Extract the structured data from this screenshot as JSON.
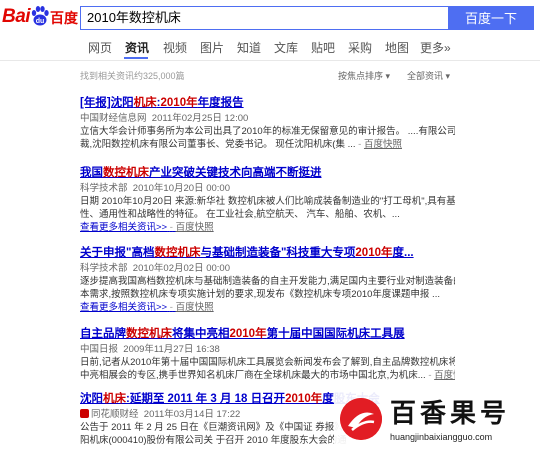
{
  "header": {
    "logo_bai": "Bai",
    "logo_du": "百度",
    "search_value": "2010年数控机床",
    "search_button": "百度一下"
  },
  "tabs": [
    "网页",
    "资讯",
    "视频",
    "图片",
    "知道",
    "文库",
    "贴吧",
    "采购",
    "地图",
    "更多»"
  ],
  "active_tab": "资讯",
  "filters": {
    "count": "找到相关资讯约325,000篇",
    "sort": "按焦点排序",
    "scope": "全部资讯"
  },
  "results": [
    {
      "title_pre": "[年报]沈阳",
      "title_em": "机床",
      "title_mid": ":",
      "title_em2": "2010年",
      "title_post": "年度报告",
      "source": "中国财经信息网",
      "time": "2011年02月25日 12:00",
      "line1": "立信大华会计师事务所为本公司出具了2010年的标准无保留意见的审计报告。 ....有限公司副总",
      "line2": "裁,沈阳数控机床有限公司董事长、党委书记。 现任沈阳机床(集 ...",
      "snapshot": "百度快照"
    },
    {
      "title_pre": "我国",
      "title_em": "数控机床",
      "title_mid": "产业突破关键技术向高端不断挺进",
      "title_em2": "",
      "title_post": "",
      "source": "科学技术部",
      "time": "2010年10月20日 00:00",
      "line1": "日期 2010年10月20日 来源:新华社 数控机床被人们比喻成装备制造业的\"打工母机\",具有基本",
      "line2": "性、通用性和战略性的特征。 在工业社会,航空航天、 汽车、船舶、农机、...",
      "more": "查看更多相关资讯>>",
      "snapshot": "百度快照"
    },
    {
      "title_pre": "关于申报\"高档",
      "title_em": "数控机床",
      "title_mid": "与基础制造装备\"科技重大专项",
      "title_em2": "2010年",
      "title_post": "度...",
      "source": "科学技术部",
      "time": "2010年02月02日 00:00",
      "line1": "逐步提高我国高档数控机床与基础制造装备的自主开发能力,满足国内主要行业对制造装备的基本",
      "line2": "本需求,按照数控机床专项实施计划的要求,现发布《数控机床专项2010年度课题申报 ...",
      "more": "查看更多相关资讯>>",
      "snapshot": "百度快照"
    },
    {
      "title_pre": "自主品牌",
      "title_em": "数控机床",
      "title_mid": "将集中亮相",
      "title_em2": "2010年",
      "title_post": "第十届中国国际机床工具展",
      "source": "中国日报",
      "time": "2009年11月27日 16:38",
      "line1": "日前,记者从2010年第十届中国国际机床工具展览会新闻发布会了解到,自主品牌数控机床将集",
      "line2": "中亮相展会的专区,携手世界知名机床厂商在全球机床最大的市场中国北京,为机床...",
      "snapshot": "百度快照"
    },
    {
      "title_pre": "沈阳",
      "title_em": "机床",
      "title_mid": ":延期至 2011 年 3 月 18 日召开",
      "title_em2": "2010年",
      "title_post": "度股东大会",
      "source": "同花顺财经",
      "time": "2011年03月14日 17:22",
      "line1": "公告于 2011 年 2 月 25 日在《巨潮资讯网》及《中国证 券报》、",
      "line2": "阳机床(000410)股份有限公司关 于召开 2010 年度股东大会的通"
    }
  ],
  "watermark": {
    "text": "百香果号",
    "url": "huangjinbaixiangguo.com"
  },
  "colors": {
    "accent": "#4e6ef2",
    "link": "#0000cc",
    "highlight": "#cc0000",
    "logo_red": "#e10602"
  }
}
